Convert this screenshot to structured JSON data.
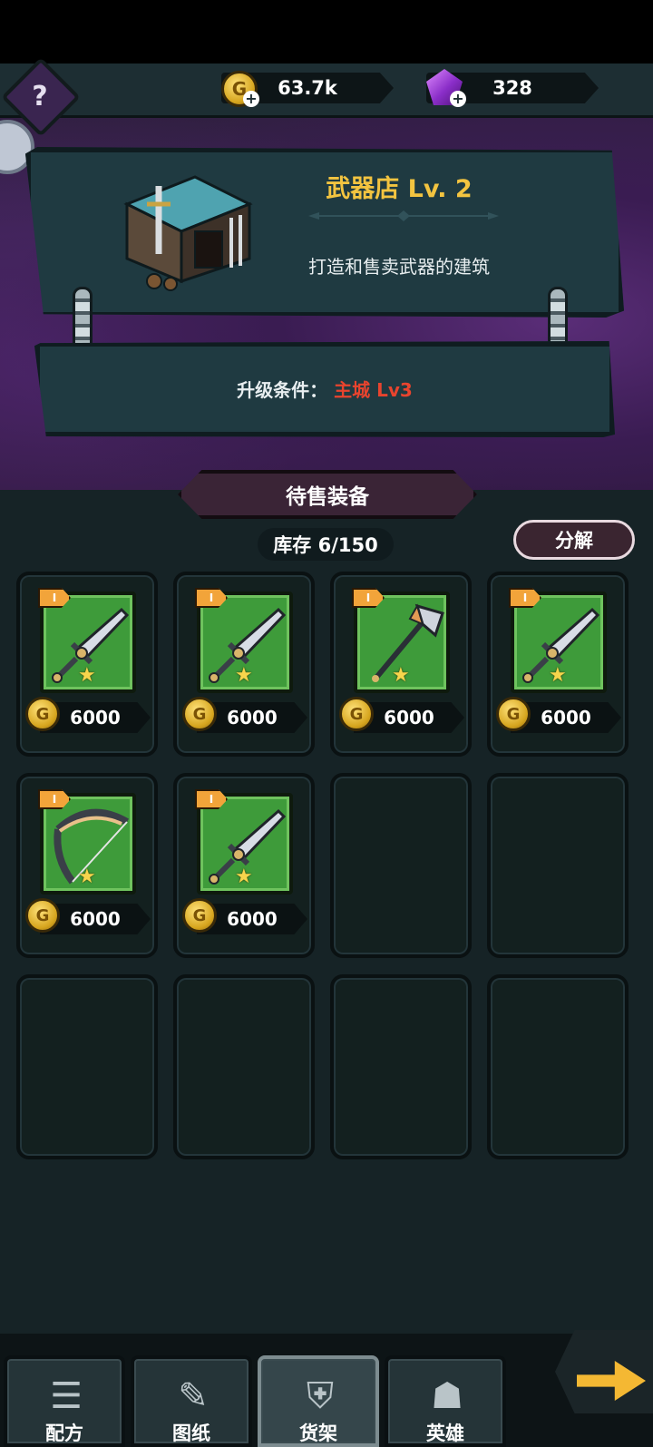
{
  "resources": {
    "gold": {
      "icon": "gold-coin-icon",
      "value": "63.7k"
    },
    "gems": {
      "icon": "purple-gem-icon",
      "value": "328"
    }
  },
  "shop": {
    "title": "武器店 Lv. 2",
    "description": "打造和售卖武器的建筑",
    "requirement_label": "升级条件：",
    "requirement_value": "主城 Lv3"
  },
  "sale": {
    "banner": "待售装备",
    "stock": "库存 6/150",
    "decompose_label": "分解"
  },
  "items": [
    {
      "weapon": "sword",
      "tier": "I",
      "stars": "★",
      "price": "6000"
    },
    {
      "weapon": "sword",
      "tier": "I",
      "stars": "★",
      "price": "6000"
    },
    {
      "weapon": "axe",
      "tier": "I",
      "stars": "★",
      "price": "6000"
    },
    {
      "weapon": "sword",
      "tier": "I",
      "stars": "★",
      "price": "6000"
    },
    {
      "weapon": "bow",
      "tier": "I",
      "stars": "★",
      "price": "6000"
    },
    {
      "weapon": "sword",
      "tier": "I",
      "stars": "★",
      "price": "6000"
    }
  ],
  "tabs": [
    {
      "label": "配方",
      "icon": "recipe-scroll-icon",
      "active": false
    },
    {
      "label": "图纸",
      "icon": "blueprint-icon",
      "active": false
    },
    {
      "label": "货架",
      "icon": "shelf-armor-icon",
      "active": true
    },
    {
      "label": "英雄",
      "icon": "hero-helmet-icon",
      "active": false
    }
  ],
  "colors": {
    "title_gold": "#f3c440",
    "requirement_red": "#e8442e",
    "rarity_green": "#3e9b3a",
    "tier_orange": "#f2a43a"
  }
}
